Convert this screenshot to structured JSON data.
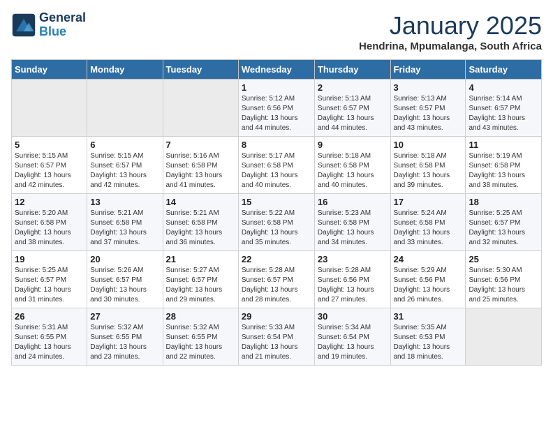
{
  "header": {
    "logo_line1": "General",
    "logo_line2": "Blue",
    "month": "January 2025",
    "location": "Hendrina, Mpumalanga, South Africa"
  },
  "weekdays": [
    "Sunday",
    "Monday",
    "Tuesday",
    "Wednesday",
    "Thursday",
    "Friday",
    "Saturday"
  ],
  "weeks": [
    [
      {
        "day": "",
        "content": ""
      },
      {
        "day": "",
        "content": ""
      },
      {
        "day": "",
        "content": ""
      },
      {
        "day": "1",
        "content": "Sunrise: 5:12 AM\nSunset: 6:56 PM\nDaylight: 13 hours and 44 minutes."
      },
      {
        "day": "2",
        "content": "Sunrise: 5:13 AM\nSunset: 6:57 PM\nDaylight: 13 hours and 44 minutes."
      },
      {
        "day": "3",
        "content": "Sunrise: 5:13 AM\nSunset: 6:57 PM\nDaylight: 13 hours and 43 minutes."
      },
      {
        "day": "4",
        "content": "Sunrise: 5:14 AM\nSunset: 6:57 PM\nDaylight: 13 hours and 43 minutes."
      }
    ],
    [
      {
        "day": "5",
        "content": "Sunrise: 5:15 AM\nSunset: 6:57 PM\nDaylight: 13 hours and 42 minutes."
      },
      {
        "day": "6",
        "content": "Sunrise: 5:15 AM\nSunset: 6:57 PM\nDaylight: 13 hours and 42 minutes."
      },
      {
        "day": "7",
        "content": "Sunrise: 5:16 AM\nSunset: 6:58 PM\nDaylight: 13 hours and 41 minutes."
      },
      {
        "day": "8",
        "content": "Sunrise: 5:17 AM\nSunset: 6:58 PM\nDaylight: 13 hours and 40 minutes."
      },
      {
        "day": "9",
        "content": "Sunrise: 5:18 AM\nSunset: 6:58 PM\nDaylight: 13 hours and 40 minutes."
      },
      {
        "day": "10",
        "content": "Sunrise: 5:18 AM\nSunset: 6:58 PM\nDaylight: 13 hours and 39 minutes."
      },
      {
        "day": "11",
        "content": "Sunrise: 5:19 AM\nSunset: 6:58 PM\nDaylight: 13 hours and 38 minutes."
      }
    ],
    [
      {
        "day": "12",
        "content": "Sunrise: 5:20 AM\nSunset: 6:58 PM\nDaylight: 13 hours and 38 minutes."
      },
      {
        "day": "13",
        "content": "Sunrise: 5:21 AM\nSunset: 6:58 PM\nDaylight: 13 hours and 37 minutes."
      },
      {
        "day": "14",
        "content": "Sunrise: 5:21 AM\nSunset: 6:58 PM\nDaylight: 13 hours and 36 minutes."
      },
      {
        "day": "15",
        "content": "Sunrise: 5:22 AM\nSunset: 6:58 PM\nDaylight: 13 hours and 35 minutes."
      },
      {
        "day": "16",
        "content": "Sunrise: 5:23 AM\nSunset: 6:58 PM\nDaylight: 13 hours and 34 minutes."
      },
      {
        "day": "17",
        "content": "Sunrise: 5:24 AM\nSunset: 6:58 PM\nDaylight: 13 hours and 33 minutes."
      },
      {
        "day": "18",
        "content": "Sunrise: 5:25 AM\nSunset: 6:57 PM\nDaylight: 13 hours and 32 minutes."
      }
    ],
    [
      {
        "day": "19",
        "content": "Sunrise: 5:25 AM\nSunset: 6:57 PM\nDaylight: 13 hours and 31 minutes."
      },
      {
        "day": "20",
        "content": "Sunrise: 5:26 AM\nSunset: 6:57 PM\nDaylight: 13 hours and 30 minutes."
      },
      {
        "day": "21",
        "content": "Sunrise: 5:27 AM\nSunset: 6:57 PM\nDaylight: 13 hours and 29 minutes."
      },
      {
        "day": "22",
        "content": "Sunrise: 5:28 AM\nSunset: 6:57 PM\nDaylight: 13 hours and 28 minutes."
      },
      {
        "day": "23",
        "content": "Sunrise: 5:28 AM\nSunset: 6:56 PM\nDaylight: 13 hours and 27 minutes."
      },
      {
        "day": "24",
        "content": "Sunrise: 5:29 AM\nSunset: 6:56 PM\nDaylight: 13 hours and 26 minutes."
      },
      {
        "day": "25",
        "content": "Sunrise: 5:30 AM\nSunset: 6:56 PM\nDaylight: 13 hours and 25 minutes."
      }
    ],
    [
      {
        "day": "26",
        "content": "Sunrise: 5:31 AM\nSunset: 6:55 PM\nDaylight: 13 hours and 24 minutes."
      },
      {
        "day": "27",
        "content": "Sunrise: 5:32 AM\nSunset: 6:55 PM\nDaylight: 13 hours and 23 minutes."
      },
      {
        "day": "28",
        "content": "Sunrise: 5:32 AM\nSunset: 6:55 PM\nDaylight: 13 hours and 22 minutes."
      },
      {
        "day": "29",
        "content": "Sunrise: 5:33 AM\nSunset: 6:54 PM\nDaylight: 13 hours and 21 minutes."
      },
      {
        "day": "30",
        "content": "Sunrise: 5:34 AM\nSunset: 6:54 PM\nDaylight: 13 hours and 19 minutes."
      },
      {
        "day": "31",
        "content": "Sunrise: 5:35 AM\nSunset: 6:53 PM\nDaylight: 13 hours and 18 minutes."
      },
      {
        "day": "",
        "content": ""
      }
    ]
  ]
}
